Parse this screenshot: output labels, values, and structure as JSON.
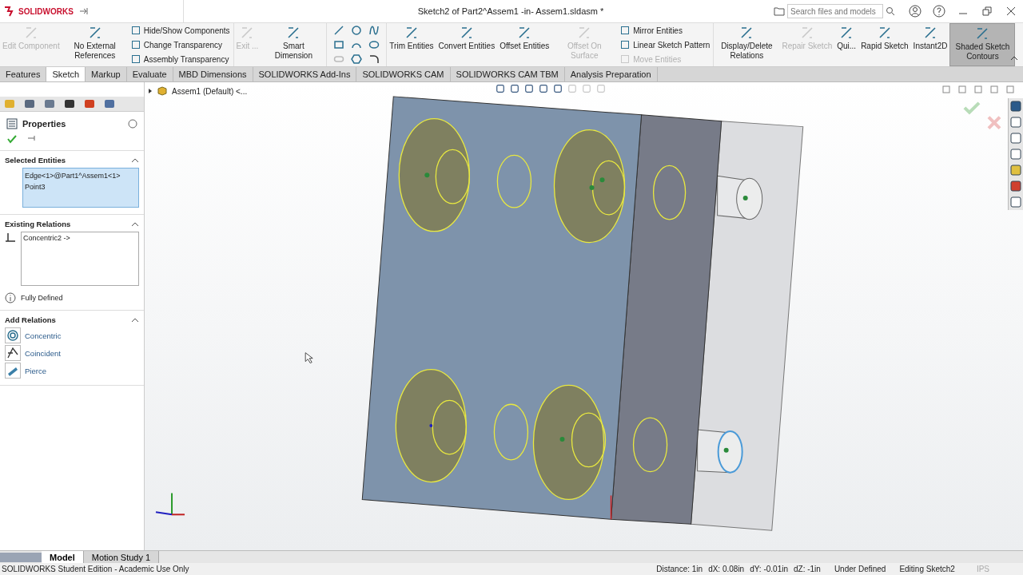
{
  "app": {
    "logo": "SOLIDWORKS",
    "title": "Sketch2 of Part2^Assem1 -in- Assem1.sldasm *",
    "search": {
      "placeholder": "Search files and models"
    }
  },
  "ribbon": [
    {
      "kind": "button",
      "label": "Edit Component",
      "disabled": true,
      "on": false
    },
    {
      "kind": "button",
      "label": "No External References",
      "disabled": false,
      "on": false
    },
    {
      "kind": "stack",
      "items": [
        {
          "label": "Hide/Show Components",
          "disabled": false
        },
        {
          "label": "Change Transparency",
          "disabled": false
        },
        {
          "label": "Assembly Transparency",
          "disabled": false
        }
      ]
    },
    {
      "kind": "button",
      "label": "Exit ...",
      "disabled": true,
      "on": false
    },
    {
      "kind": "button",
      "label": "Smart Dimension",
      "disabled": false,
      "on": false
    },
    {
      "kind": "tools"
    },
    {
      "kind": "button",
      "label": "Trim Entities",
      "disabled": false,
      "on": false
    },
    {
      "kind": "button",
      "label": "Convert Entities",
      "disabled": false,
      "on": false
    },
    {
      "kind": "button",
      "label": "Offset Entities",
      "disabled": false,
      "on": false
    },
    {
      "kind": "button",
      "label": "Offset On Surface",
      "disabled": true,
      "on": false
    },
    {
      "kind": "stack",
      "items": [
        {
          "label": "Mirror Entities",
          "disabled": false
        },
        {
          "label": "Linear Sketch Pattern",
          "disabled": false
        },
        {
          "label": "Move Entities",
          "disabled": true
        }
      ]
    },
    {
      "kind": "button",
      "label": "Display/Delete Relations",
      "disabled": false,
      "on": false
    },
    {
      "kind": "button",
      "label": "Repair Sketch",
      "disabled": true,
      "on": false
    },
    {
      "kind": "button",
      "label": "Qui...",
      "disabled": false,
      "on": false
    },
    {
      "kind": "button",
      "label": "Rapid Sketch",
      "disabled": false,
      "on": false
    },
    {
      "kind": "button",
      "label": "Instant2D",
      "disabled": false,
      "on": false
    },
    {
      "kind": "button",
      "label": "Shaded Sketch Contours",
      "disabled": false,
      "on": true
    }
  ],
  "tabs": [
    {
      "label": "Features",
      "selected": false
    },
    {
      "label": "Sketch",
      "selected": true
    },
    {
      "label": "Markup",
      "selected": false
    },
    {
      "label": "Evaluate",
      "selected": false
    },
    {
      "label": "MBD Dimensions",
      "selected": false
    },
    {
      "label": "SOLIDWORKS Add-Ins",
      "selected": false
    },
    {
      "label": "SOLIDWORKS CAM",
      "selected": false
    },
    {
      "label": "SOLIDWORKS CAM TBM",
      "selected": false
    },
    {
      "label": "Analysis Preparation",
      "selected": false
    }
  ],
  "panel": {
    "title": "Properties",
    "selected_entities": {
      "title": "Selected Entities",
      "items": [
        "Edge<1>@Part1^Assem1<1>",
        "Point3"
      ]
    },
    "existing_relations": {
      "title": "Existing Relations",
      "items": [
        "Concentric2 ->"
      ],
      "status": "Fully Defined"
    },
    "add_relations": {
      "title": "Add Relations",
      "items": [
        "Concentric",
        "Coincident",
        "Pierce"
      ]
    }
  },
  "tree": {
    "root": "Assem1 (Default) <..."
  },
  "bottom_tabs": [
    {
      "label": "Model",
      "selected": true
    },
    {
      "label": "Motion Study 1",
      "selected": false
    }
  ],
  "status_bar": {
    "edition": "SOLIDWORKS Student Edition - Academic Use Only",
    "readings": [
      "Distance: 1in",
      "dX: 0.08in",
      "dY: -0.01in",
      "dZ: -1in"
    ],
    "state": "Under Defined",
    "mode": "Editing Sketch2",
    "units": "IPS"
  }
}
